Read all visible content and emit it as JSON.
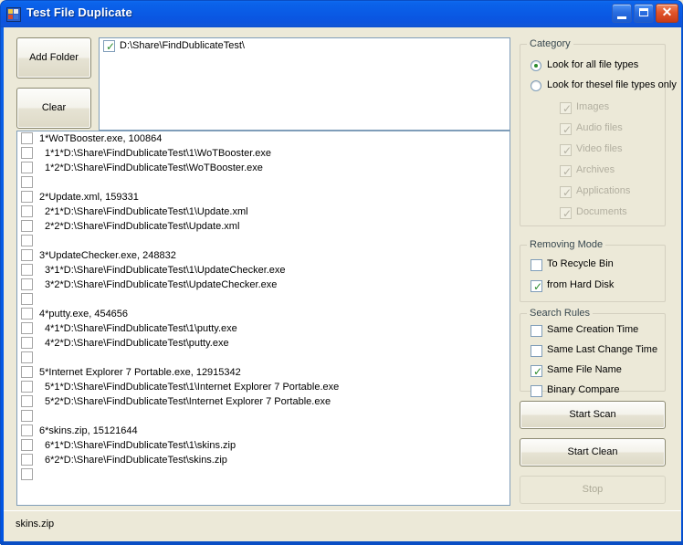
{
  "window": {
    "title": "Test File Duplicate",
    "icon": "app-icon",
    "buttons": {
      "minimize": "–",
      "maximize": "□",
      "close": "✕"
    }
  },
  "toolbar": {
    "add_folder_label": "Add Folder",
    "clear_label": "Clear"
  },
  "folder_list": {
    "items": [
      {
        "checked": true,
        "path": "D:\\Share\\FindDublicateTest\\"
      }
    ]
  },
  "results": {
    "rows": [
      {
        "indent": 0,
        "checked": false,
        "text": "1*WoTBooster.exe,  100864"
      },
      {
        "indent": 1,
        "checked": false,
        "text": "1*1*D:\\Share\\FindDublicateTest\\1\\WoTBooster.exe"
      },
      {
        "indent": 1,
        "checked": false,
        "text": "1*2*D:\\Share\\FindDublicateTest\\WoTBooster.exe"
      },
      {
        "indent": 0,
        "checked": false,
        "text": ""
      },
      {
        "indent": 0,
        "checked": false,
        "text": "2*Update.xml,  159331"
      },
      {
        "indent": 1,
        "checked": false,
        "text": "2*1*D:\\Share\\FindDublicateTest\\1\\Update.xml"
      },
      {
        "indent": 1,
        "checked": false,
        "text": "2*2*D:\\Share\\FindDublicateTest\\Update.xml"
      },
      {
        "indent": 0,
        "checked": false,
        "text": ""
      },
      {
        "indent": 0,
        "checked": false,
        "text": "3*UpdateChecker.exe,  248832"
      },
      {
        "indent": 1,
        "checked": false,
        "text": "3*1*D:\\Share\\FindDublicateTest\\1\\UpdateChecker.exe"
      },
      {
        "indent": 1,
        "checked": false,
        "text": "3*2*D:\\Share\\FindDublicateTest\\UpdateChecker.exe"
      },
      {
        "indent": 0,
        "checked": false,
        "text": ""
      },
      {
        "indent": 0,
        "checked": false,
        "text": "4*putty.exe,  454656"
      },
      {
        "indent": 1,
        "checked": false,
        "text": "4*1*D:\\Share\\FindDublicateTest\\1\\putty.exe"
      },
      {
        "indent": 1,
        "checked": false,
        "text": "4*2*D:\\Share\\FindDublicateTest\\putty.exe"
      },
      {
        "indent": 0,
        "checked": false,
        "text": ""
      },
      {
        "indent": 0,
        "checked": false,
        "text": "5*Internet Explorer 7 Portable.exe,  12915342"
      },
      {
        "indent": 1,
        "checked": false,
        "text": "5*1*D:\\Share\\FindDublicateTest\\1\\Internet Explorer 7 Portable.exe"
      },
      {
        "indent": 1,
        "checked": false,
        "text": "5*2*D:\\Share\\FindDublicateTest\\Internet Explorer 7 Portable.exe"
      },
      {
        "indent": 0,
        "checked": false,
        "text": ""
      },
      {
        "indent": 0,
        "checked": false,
        "text": "6*skins.zip,  15121644"
      },
      {
        "indent": 1,
        "checked": false,
        "text": "6*1*D:\\Share\\FindDublicateTest\\1\\skins.zip"
      },
      {
        "indent": 1,
        "checked": false,
        "text": "6*2*D:\\Share\\FindDublicateTest\\skins.zip"
      },
      {
        "indent": 0,
        "checked": false,
        "text": ""
      }
    ]
  },
  "category": {
    "title": "Category",
    "radios": [
      {
        "label": "Look for all file types",
        "selected": true
      },
      {
        "label": "Look for thesel file types only",
        "selected": false
      }
    ],
    "file_types": [
      {
        "label": "Images",
        "checked": true,
        "enabled": false
      },
      {
        "label": "Audio files",
        "checked": true,
        "enabled": false
      },
      {
        "label": "Video files",
        "checked": true,
        "enabled": false
      },
      {
        "label": "Archives",
        "checked": true,
        "enabled": false
      },
      {
        "label": "Applications",
        "checked": true,
        "enabled": false
      },
      {
        "label": "Documents",
        "checked": true,
        "enabled": false
      }
    ]
  },
  "removing_mode": {
    "title": "Removing Mode",
    "options": [
      {
        "label": "To Recycle Bin",
        "checked": false
      },
      {
        "label": "from Hard Disk",
        "checked": true
      }
    ]
  },
  "search_rules": {
    "title": "Search Rules",
    "options": [
      {
        "label": "Same Creation Time",
        "checked": false
      },
      {
        "label": "Same Last Change Time",
        "checked": false
      },
      {
        "label": "Same File Name",
        "checked": true
      },
      {
        "label": "Binary Compare",
        "checked": false
      }
    ]
  },
  "actions": {
    "start_scan_label": "Start Scan",
    "start_clean_label": "Start Clean",
    "stop_label": "Stop",
    "stop_enabled": false
  },
  "statusbar": {
    "text": "skins.zip"
  },
  "colors": {
    "titlebar_blue": "#0a57e2",
    "form_background": "#ece9d8",
    "listbox_background": "#ffffff",
    "groupbox_border": "#d4d0c0",
    "groupbox_label": "#38484f",
    "check_green": "#2a8a2a",
    "disabled_text": "#b2afa0"
  }
}
